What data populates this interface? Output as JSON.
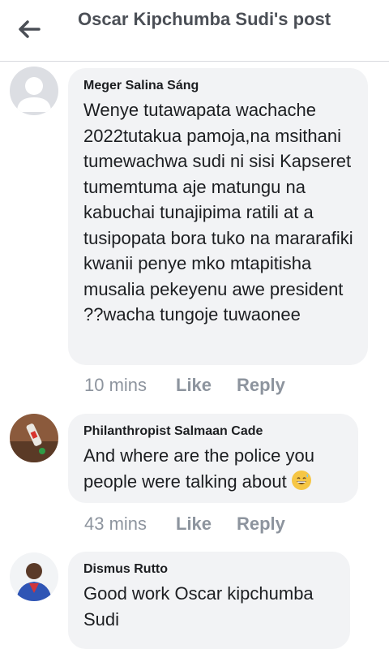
{
  "header": {
    "back_icon": "arrow-left-icon",
    "title": "Oscar Kipchumba Sudi's post"
  },
  "comments": [
    {
      "author": "Meger Salina Sáng",
      "text": "Wenye tutawapata wachache 2022tutakua pamoja,na msithani tumewachwa sudi ni sisi Kapseret tumemtuma aje matungu na kabuchai tunajipima ratili at a tusipopata bora tuko na mararafiki kwanii penye mko mtapitisha musalia pekeyenu awe president ??wacha tungoje tuwaonee",
      "time": "10 mins",
      "like": "Like",
      "reply": "Reply",
      "avatar": "default-avatar-icon"
    },
    {
      "author": "Philanthropist Salmaan Cade",
      "text": "And where are the police you people were talking about",
      "emoji": "grinning-sweat-emoji",
      "time": "43 mins",
      "like": "Like",
      "reply": "Reply",
      "avatar": "profile-photo-avatar"
    },
    {
      "author": "Dismus Rutto",
      "text": "Good work Oscar kipchumba Sudi",
      "avatar": "profile-photo-avatar"
    }
  ],
  "colors": {
    "bubble": "#f2f3f5",
    "muted": "#8d949e",
    "title": "#4b4f56"
  }
}
